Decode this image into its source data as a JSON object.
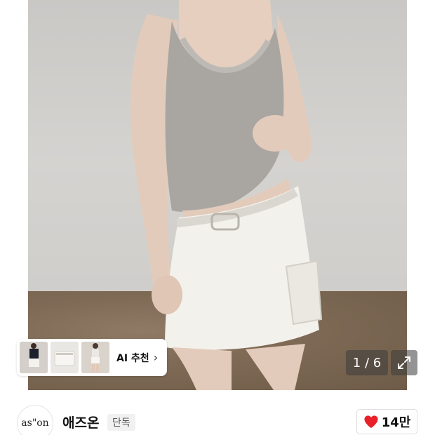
{
  "gallery": {
    "current_page": "1",
    "total_pages": "6",
    "page_counter": "1 / 6"
  },
  "ai_recommend": {
    "label": "AI 추천",
    "chevron": "›"
  },
  "brand": {
    "logo_text": "as\"on",
    "name": "애즈온",
    "badge": "단독"
  },
  "like": {
    "count": "14만",
    "icon": "heart-icon",
    "color": "#e8202a"
  },
  "icons": {
    "expand": "expand-arrows-icon",
    "heart": "heart-icon",
    "chevron": "chevron-right-icon"
  }
}
